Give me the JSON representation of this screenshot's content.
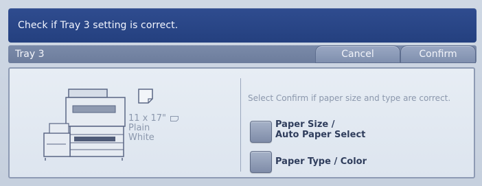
{
  "message": "Check if Tray 3 setting is correct.",
  "header": {
    "title": "Tray 3",
    "cancel_label": "Cancel",
    "confirm_label": "Confirm"
  },
  "paper": {
    "size": "11 x 17\"",
    "type": "Plain",
    "color": "White"
  },
  "instruction": "Select Confirm if paper size and type are correct.",
  "options": {
    "paper_size_line1": "Paper Size /",
    "paper_size_line2": "Auto Paper Select",
    "paper_type": "Paper Type / Color"
  },
  "icons": {
    "printer": "printer-icon",
    "paper": "paper-sheet-icon",
    "orientation": "landscape-orientation-icon"
  },
  "colors": {
    "message_bar": "#2f4c8f",
    "title_bar": "#7b8ba9",
    "panel": "#e7edf4",
    "muted_text": "#8b97ac"
  }
}
